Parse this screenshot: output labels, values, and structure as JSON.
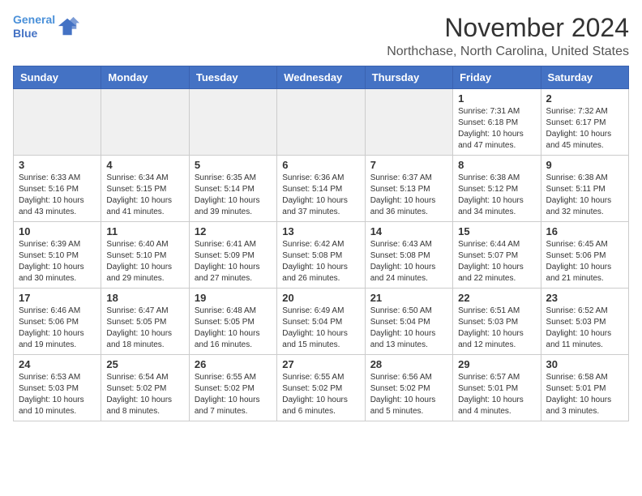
{
  "header": {
    "logo_line1": "General",
    "logo_line2": "Blue",
    "month_title": "November 2024",
    "subtitle": "Northchase, North Carolina, United States"
  },
  "weekdays": [
    "Sunday",
    "Monday",
    "Tuesday",
    "Wednesday",
    "Thursday",
    "Friday",
    "Saturday"
  ],
  "weeks": [
    [
      {
        "day": "",
        "empty": true
      },
      {
        "day": "",
        "empty": true
      },
      {
        "day": "",
        "empty": true
      },
      {
        "day": "",
        "empty": true
      },
      {
        "day": "",
        "empty": true
      },
      {
        "day": "1",
        "sunrise": "Sunrise: 7:31 AM",
        "sunset": "Sunset: 6:18 PM",
        "daylight": "Daylight: 10 hours and 47 minutes."
      },
      {
        "day": "2",
        "sunrise": "Sunrise: 7:32 AM",
        "sunset": "Sunset: 6:17 PM",
        "daylight": "Daylight: 10 hours and 45 minutes."
      }
    ],
    [
      {
        "day": "3",
        "sunrise": "Sunrise: 6:33 AM",
        "sunset": "Sunset: 5:16 PM",
        "daylight": "Daylight: 10 hours and 43 minutes."
      },
      {
        "day": "4",
        "sunrise": "Sunrise: 6:34 AM",
        "sunset": "Sunset: 5:15 PM",
        "daylight": "Daylight: 10 hours and 41 minutes."
      },
      {
        "day": "5",
        "sunrise": "Sunrise: 6:35 AM",
        "sunset": "Sunset: 5:14 PM",
        "daylight": "Daylight: 10 hours and 39 minutes."
      },
      {
        "day": "6",
        "sunrise": "Sunrise: 6:36 AM",
        "sunset": "Sunset: 5:14 PM",
        "daylight": "Daylight: 10 hours and 37 minutes."
      },
      {
        "day": "7",
        "sunrise": "Sunrise: 6:37 AM",
        "sunset": "Sunset: 5:13 PM",
        "daylight": "Daylight: 10 hours and 36 minutes."
      },
      {
        "day": "8",
        "sunrise": "Sunrise: 6:38 AM",
        "sunset": "Sunset: 5:12 PM",
        "daylight": "Daylight: 10 hours and 34 minutes."
      },
      {
        "day": "9",
        "sunrise": "Sunrise: 6:38 AM",
        "sunset": "Sunset: 5:11 PM",
        "daylight": "Daylight: 10 hours and 32 minutes."
      }
    ],
    [
      {
        "day": "10",
        "sunrise": "Sunrise: 6:39 AM",
        "sunset": "Sunset: 5:10 PM",
        "daylight": "Daylight: 10 hours and 30 minutes."
      },
      {
        "day": "11",
        "sunrise": "Sunrise: 6:40 AM",
        "sunset": "Sunset: 5:10 PM",
        "daylight": "Daylight: 10 hours and 29 minutes."
      },
      {
        "day": "12",
        "sunrise": "Sunrise: 6:41 AM",
        "sunset": "Sunset: 5:09 PM",
        "daylight": "Daylight: 10 hours and 27 minutes."
      },
      {
        "day": "13",
        "sunrise": "Sunrise: 6:42 AM",
        "sunset": "Sunset: 5:08 PM",
        "daylight": "Daylight: 10 hours and 26 minutes."
      },
      {
        "day": "14",
        "sunrise": "Sunrise: 6:43 AM",
        "sunset": "Sunset: 5:08 PM",
        "daylight": "Daylight: 10 hours and 24 minutes."
      },
      {
        "day": "15",
        "sunrise": "Sunrise: 6:44 AM",
        "sunset": "Sunset: 5:07 PM",
        "daylight": "Daylight: 10 hours and 22 minutes."
      },
      {
        "day": "16",
        "sunrise": "Sunrise: 6:45 AM",
        "sunset": "Sunset: 5:06 PM",
        "daylight": "Daylight: 10 hours and 21 minutes."
      }
    ],
    [
      {
        "day": "17",
        "sunrise": "Sunrise: 6:46 AM",
        "sunset": "Sunset: 5:06 PM",
        "daylight": "Daylight: 10 hours and 19 minutes."
      },
      {
        "day": "18",
        "sunrise": "Sunrise: 6:47 AM",
        "sunset": "Sunset: 5:05 PM",
        "daylight": "Daylight: 10 hours and 18 minutes."
      },
      {
        "day": "19",
        "sunrise": "Sunrise: 6:48 AM",
        "sunset": "Sunset: 5:05 PM",
        "daylight": "Daylight: 10 hours and 16 minutes."
      },
      {
        "day": "20",
        "sunrise": "Sunrise: 6:49 AM",
        "sunset": "Sunset: 5:04 PM",
        "daylight": "Daylight: 10 hours and 15 minutes."
      },
      {
        "day": "21",
        "sunrise": "Sunrise: 6:50 AM",
        "sunset": "Sunset: 5:04 PM",
        "daylight": "Daylight: 10 hours and 13 minutes."
      },
      {
        "day": "22",
        "sunrise": "Sunrise: 6:51 AM",
        "sunset": "Sunset: 5:03 PM",
        "daylight": "Daylight: 10 hours and 12 minutes."
      },
      {
        "day": "23",
        "sunrise": "Sunrise: 6:52 AM",
        "sunset": "Sunset: 5:03 PM",
        "daylight": "Daylight: 10 hours and 11 minutes."
      }
    ],
    [
      {
        "day": "24",
        "sunrise": "Sunrise: 6:53 AM",
        "sunset": "Sunset: 5:03 PM",
        "daylight": "Daylight: 10 hours and 10 minutes."
      },
      {
        "day": "25",
        "sunrise": "Sunrise: 6:54 AM",
        "sunset": "Sunset: 5:02 PM",
        "daylight": "Daylight: 10 hours and 8 minutes."
      },
      {
        "day": "26",
        "sunrise": "Sunrise: 6:55 AM",
        "sunset": "Sunset: 5:02 PM",
        "daylight": "Daylight: 10 hours and 7 minutes."
      },
      {
        "day": "27",
        "sunrise": "Sunrise: 6:55 AM",
        "sunset": "Sunset: 5:02 PM",
        "daylight": "Daylight: 10 hours and 6 minutes."
      },
      {
        "day": "28",
        "sunrise": "Sunrise: 6:56 AM",
        "sunset": "Sunset: 5:02 PM",
        "daylight": "Daylight: 10 hours and 5 minutes."
      },
      {
        "day": "29",
        "sunrise": "Sunrise: 6:57 AM",
        "sunset": "Sunset: 5:01 PM",
        "daylight": "Daylight: 10 hours and 4 minutes."
      },
      {
        "day": "30",
        "sunrise": "Sunrise: 6:58 AM",
        "sunset": "Sunset: 5:01 PM",
        "daylight": "Daylight: 10 hours and 3 minutes."
      }
    ]
  ]
}
